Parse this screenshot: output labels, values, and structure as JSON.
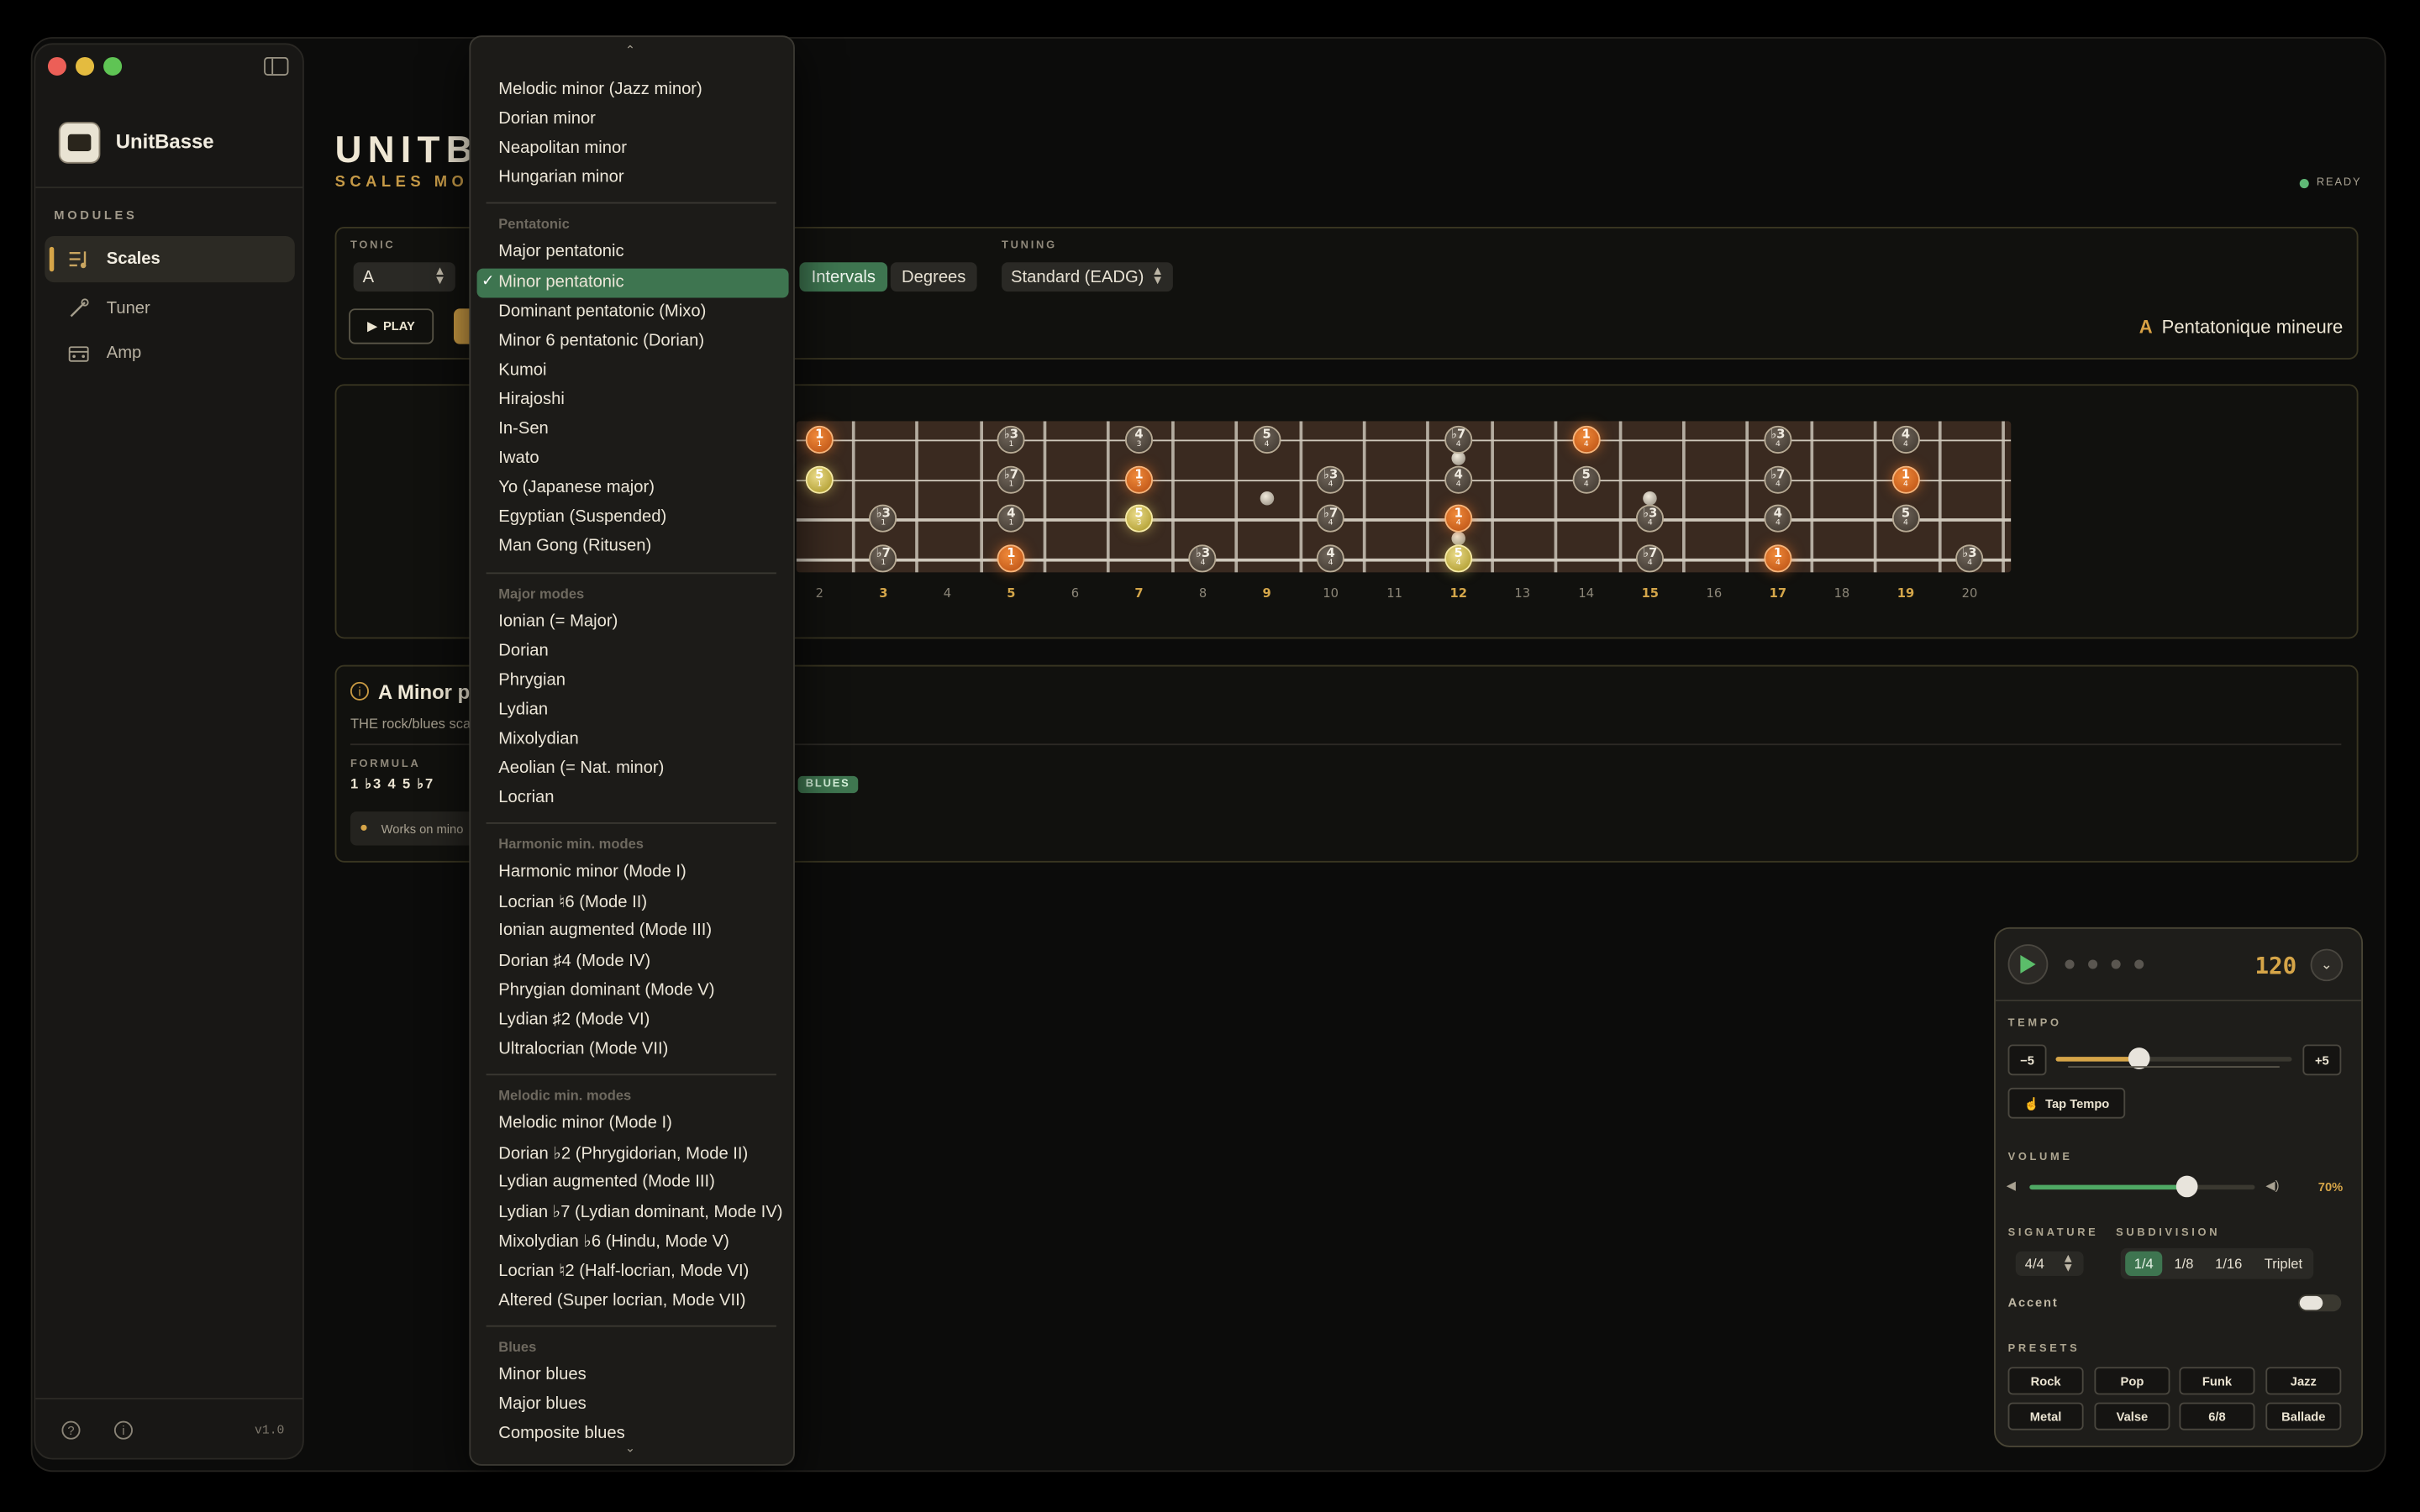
{
  "app": {
    "name": "UnitBasse",
    "version": "v1.0",
    "title": "UNITBA",
    "subtitle": "SCALES MOD",
    "status": "READY"
  },
  "sidebar": {
    "section_label": "MODULES",
    "items": [
      {
        "label": "Scales",
        "icon": "scales-icon",
        "active": true
      },
      {
        "label": "Tuner",
        "icon": "tuner-icon",
        "active": false
      },
      {
        "label": "Amp",
        "icon": "amp-icon",
        "active": false
      }
    ]
  },
  "controls": {
    "tonic_label": "TONIC",
    "tonic_value": "A",
    "play_label": "PLAY",
    "view_options": [
      "Intervals",
      "Degrees"
    ],
    "view_selected": "Intervals",
    "tuning_label": "TUNING",
    "tuning_value": "Standard (EADG)",
    "scale_root": "A",
    "scale_name": "Pentatonique mineure"
  },
  "fretboard": {
    "visible_frets": [
      "2",
      "3",
      "4",
      "5",
      "6",
      "7",
      "8",
      "9",
      "10",
      "11",
      "12",
      "13",
      "14",
      "15",
      "16",
      "17",
      "18",
      "19",
      "20"
    ],
    "highlighted_frets": [
      "3",
      "5",
      "7",
      "9",
      "12",
      "15",
      "17",
      "19"
    ],
    "notes": [
      {
        "string": 1,
        "fret": 2,
        "label": "1",
        "finger": "1",
        "kind": "root"
      },
      {
        "string": 1,
        "fret": 5,
        "label": "♭3",
        "finger": "1",
        "kind": "plain"
      },
      {
        "string": 1,
        "fret": 7,
        "label": "4",
        "finger": "3",
        "kind": "plain"
      },
      {
        "string": 1,
        "fret": 9,
        "label": "5",
        "finger": "4",
        "kind": "plain"
      },
      {
        "string": 1,
        "fret": 12,
        "label": "♭7",
        "finger": "4",
        "kind": "plain"
      },
      {
        "string": 1,
        "fret": 14,
        "label": "1",
        "finger": "4",
        "kind": "root"
      },
      {
        "string": 1,
        "fret": 17,
        "label": "♭3",
        "finger": "4",
        "kind": "plain"
      },
      {
        "string": 1,
        "fret": 19,
        "label": "4",
        "finger": "4",
        "kind": "plain"
      },
      {
        "string": 2,
        "fret": 2,
        "label": "5",
        "finger": "1",
        "kind": "fifth"
      },
      {
        "string": 2,
        "fret": 5,
        "label": "♭7",
        "finger": "1",
        "kind": "plain"
      },
      {
        "string": 2,
        "fret": 7,
        "label": "1",
        "finger": "3",
        "kind": "root"
      },
      {
        "string": 2,
        "fret": 10,
        "label": "♭3",
        "finger": "4",
        "kind": "plain"
      },
      {
        "string": 2,
        "fret": 12,
        "label": "4",
        "finger": "4",
        "kind": "plain"
      },
      {
        "string": 2,
        "fret": 14,
        "label": "5",
        "finger": "4",
        "kind": "plain"
      },
      {
        "string": 2,
        "fret": 17,
        "label": "♭7",
        "finger": "4",
        "kind": "plain"
      },
      {
        "string": 2,
        "fret": 19,
        "label": "1",
        "finger": "4",
        "kind": "root"
      },
      {
        "string": 3,
        "fret": 3,
        "label": "♭3",
        "finger": "1",
        "kind": "plain"
      },
      {
        "string": 3,
        "fret": 5,
        "label": "4",
        "finger": "1",
        "kind": "plain"
      },
      {
        "string": 3,
        "fret": 7,
        "label": "5",
        "finger": "3",
        "kind": "fifth"
      },
      {
        "string": 3,
        "fret": 10,
        "label": "♭7",
        "finger": "4",
        "kind": "plain"
      },
      {
        "string": 3,
        "fret": 12,
        "label": "1",
        "finger": "4",
        "kind": "root"
      },
      {
        "string": 3,
        "fret": 15,
        "label": "♭3",
        "finger": "4",
        "kind": "plain"
      },
      {
        "string": 3,
        "fret": 17,
        "label": "4",
        "finger": "4",
        "kind": "plain"
      },
      {
        "string": 3,
        "fret": 19,
        "label": "5",
        "finger": "4",
        "kind": "plain"
      },
      {
        "string": 4,
        "fret": 3,
        "label": "♭7",
        "finger": "1",
        "kind": "plain"
      },
      {
        "string": 4,
        "fret": 5,
        "label": "1",
        "finger": "1",
        "kind": "root"
      },
      {
        "string": 4,
        "fret": 8,
        "label": "♭3",
        "finger": "4",
        "kind": "plain"
      },
      {
        "string": 4,
        "fret": 10,
        "label": "4",
        "finger": "4",
        "kind": "plain"
      },
      {
        "string": 4,
        "fret": 12,
        "label": "5",
        "finger": "4",
        "kind": "fifth"
      },
      {
        "string": 4,
        "fret": 15,
        "label": "♭7",
        "finger": "4",
        "kind": "plain"
      },
      {
        "string": 4,
        "fret": 17,
        "label": "1",
        "finger": "4",
        "kind": "root"
      },
      {
        "string": 4,
        "fret": 20,
        "label": "♭3",
        "finger": "4",
        "kind": "plain"
      }
    ]
  },
  "info": {
    "title": "A Minor pe",
    "description": "THE rock/blues sca",
    "formula_label": "FORMULA",
    "formula": "1 ♭3 4 5 ♭7",
    "tip": "Works on mino",
    "badge": "BLUES"
  },
  "dropdown": {
    "selected": "Minor pentatonic",
    "items": [
      {
        "type": "item",
        "label": "Melodic minor (Jazz minor)"
      },
      {
        "type": "item",
        "label": "Dorian minor"
      },
      {
        "type": "item",
        "label": "Neapolitan minor"
      },
      {
        "type": "item",
        "label": "Hungarian minor"
      },
      {
        "type": "sep"
      },
      {
        "type": "header",
        "label": "Pentatonic"
      },
      {
        "type": "item",
        "label": "Major pentatonic"
      },
      {
        "type": "item",
        "label": "Minor pentatonic",
        "checked": true
      },
      {
        "type": "item",
        "label": "Dominant pentatonic (Mixo)"
      },
      {
        "type": "item",
        "label": "Minor 6 pentatonic (Dorian)"
      },
      {
        "type": "item",
        "label": "Kumoi"
      },
      {
        "type": "item",
        "label": "Hirajoshi"
      },
      {
        "type": "item",
        "label": "In-Sen"
      },
      {
        "type": "item",
        "label": "Iwato"
      },
      {
        "type": "item",
        "label": "Yo (Japanese major)"
      },
      {
        "type": "item",
        "label": "Egyptian (Suspended)"
      },
      {
        "type": "item",
        "label": "Man Gong (Ritusen)"
      },
      {
        "type": "sep"
      },
      {
        "type": "header",
        "label": "Major modes"
      },
      {
        "type": "item",
        "label": "Ionian (= Major)"
      },
      {
        "type": "item",
        "label": "Dorian"
      },
      {
        "type": "item",
        "label": "Phrygian"
      },
      {
        "type": "item",
        "label": "Lydian"
      },
      {
        "type": "item",
        "label": "Mixolydian"
      },
      {
        "type": "item",
        "label": "Aeolian (= Nat. minor)"
      },
      {
        "type": "item",
        "label": "Locrian"
      },
      {
        "type": "sep"
      },
      {
        "type": "header",
        "label": "Harmonic min. modes"
      },
      {
        "type": "item",
        "label": "Harmonic minor (Mode I)"
      },
      {
        "type": "item",
        "label": "Locrian ♮6 (Mode II)"
      },
      {
        "type": "item",
        "label": "Ionian augmented (Mode III)"
      },
      {
        "type": "item",
        "label": "Dorian ♯4 (Mode IV)"
      },
      {
        "type": "item",
        "label": "Phrygian dominant (Mode V)"
      },
      {
        "type": "item",
        "label": "Lydian ♯2 (Mode VI)"
      },
      {
        "type": "item",
        "label": "Ultralocrian (Mode VII)"
      },
      {
        "type": "sep"
      },
      {
        "type": "header",
        "label": "Melodic min. modes"
      },
      {
        "type": "item",
        "label": "Melodic minor (Mode I)"
      },
      {
        "type": "item",
        "label": "Dorian ♭2 (Phrygidorian, Mode II)"
      },
      {
        "type": "item",
        "label": "Lydian augmented (Mode III)"
      },
      {
        "type": "item",
        "label": "Lydian ♭7 (Lydian dominant, Mode IV)"
      },
      {
        "type": "item",
        "label": "Mixolydian ♭6 (Hindu, Mode V)"
      },
      {
        "type": "item",
        "label": "Locrian ♮2 (Half-locrian, Mode VI)"
      },
      {
        "type": "item",
        "label": "Altered (Super locrian, Mode VII)"
      },
      {
        "type": "sep"
      },
      {
        "type": "header",
        "label": "Blues"
      },
      {
        "type": "item",
        "label": "Minor blues"
      },
      {
        "type": "item",
        "label": "Major blues"
      },
      {
        "type": "item",
        "label": "Composite blues"
      }
    ]
  },
  "metronome": {
    "bpm": "120",
    "tempo_label": "TEMPO",
    "minus_label": "−5",
    "plus_label": "+5",
    "tempo_fraction": 0.35,
    "tap_label": "Tap Tempo",
    "volume_label": "VOLUME",
    "volume_value": "70%",
    "volume_fraction": 0.7,
    "signature_label": "SIGNATURE",
    "signature_value": "4/4",
    "subdivision_label": "SUBDIVISION",
    "subdivisions": [
      "1/4",
      "1/8",
      "1/16",
      "Triplet"
    ],
    "subdivision_selected": "1/4",
    "accent_label": "Accent",
    "accent_on": false,
    "presets_label": "PRESETS",
    "presets": [
      "Rock",
      "Pop",
      "Funk",
      "Jazz",
      "Metal",
      "Valse",
      "6/8",
      "Ballade"
    ]
  },
  "colors": {
    "accent": "#d6a548",
    "green": "#3e7550",
    "root": "#e8772f",
    "fifth": "#d8c85a"
  }
}
